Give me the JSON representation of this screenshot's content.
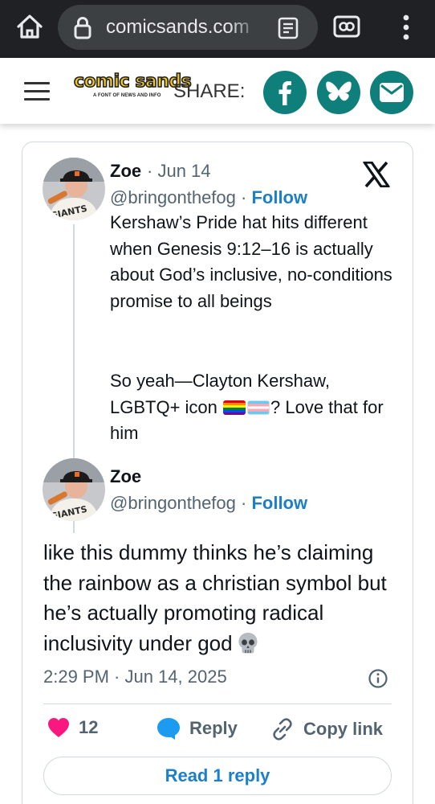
{
  "browser": {
    "url": "comicsands.com",
    "icons": [
      "home-icon",
      "lock-icon",
      "reader-mode-icon",
      "tab-switcher-icon",
      "more-vert-icon"
    ]
  },
  "site": {
    "logo_text": "comic sands",
    "logo_tagline": "A FONT OF NEWS AND INFO",
    "share_label": "SHARE:",
    "share_buttons": [
      "facebook-icon",
      "bluesky-icon",
      "email-icon"
    ],
    "accent_color": "#0f7f7c"
  },
  "embed": {
    "quoted_tweet": {
      "name": "Zoe",
      "separator": "·",
      "date": "Jun 14",
      "handle": "@bringonthefog",
      "follow_label": "Follow",
      "text_p1": "Kershaw’s Pride hat hits different when Genesis 9:12–16 is actually about God’s inclusive, no-conditions promise to all beings",
      "text_p2_before": "So yeah—Clayton Kershaw, LGBTQ+ icon ",
      "text_p2_after": "? Love that for him",
      "emoji": [
        "rainbow-flag",
        "transgender-flag"
      ]
    },
    "main_tweet": {
      "name": "Zoe",
      "handle": "@bringonthefog",
      "follow_label": "Follow",
      "text": "like this dummy thinks he’s claiming the rainbow as a christian symbol but he’s actually promoting radical inclusivity under god",
      "emoji": "skull",
      "timestamp": "2:29 PM · Jun 14, 2025"
    },
    "actions": {
      "like_count": "12",
      "reply_label": "Reply",
      "copy_label": "Copy link"
    },
    "read_replies_label": "Read 1 reply",
    "colors": {
      "like": "#f91880",
      "link": "#1d7fc7",
      "muted": "#536471"
    }
  }
}
